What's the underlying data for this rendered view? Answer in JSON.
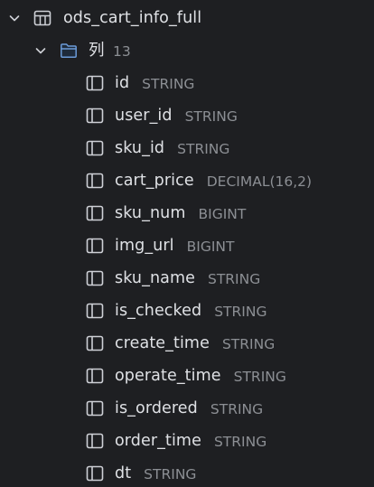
{
  "table": {
    "name": "ods_cart_info_full",
    "expanded": true,
    "icon": "table-icon",
    "folder": {
      "label": "列",
      "count": "13",
      "expanded": true,
      "icon": "folder-icon",
      "columns": [
        {
          "name": "id",
          "type": "STRING"
        },
        {
          "name": "user_id",
          "type": "STRING"
        },
        {
          "name": "sku_id",
          "type": "STRING"
        },
        {
          "name": "cart_price",
          "type": "DECIMAL(16,2)"
        },
        {
          "name": "sku_num",
          "type": "BIGINT"
        },
        {
          "name": "img_url",
          "type": "BIGINT"
        },
        {
          "name": "sku_name",
          "type": "STRING"
        },
        {
          "name": "is_checked",
          "type": "STRING"
        },
        {
          "name": "create_time",
          "type": "STRING"
        },
        {
          "name": "operate_time",
          "type": "STRING"
        },
        {
          "name": "is_ordered",
          "type": "STRING"
        },
        {
          "name": "order_time",
          "type": "STRING"
        },
        {
          "name": "dt",
          "type": "STRING"
        }
      ]
    }
  },
  "colors": {
    "background": "#1e1f22",
    "text": "#dfe1e5",
    "muted": "#8c8f94",
    "folder": "#6b9bd8",
    "icon": "#ced0d6"
  }
}
